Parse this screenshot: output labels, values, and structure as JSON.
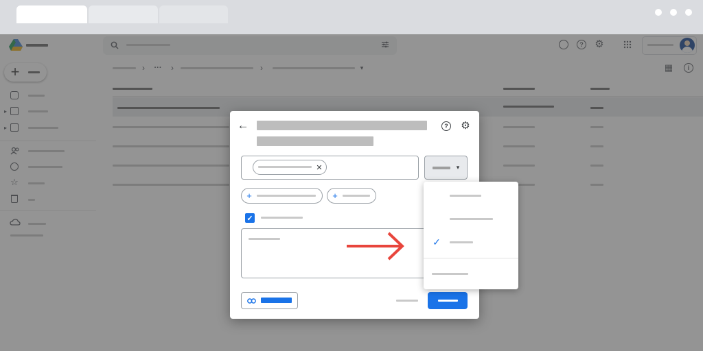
{
  "colors": {
    "accent": "#1a73e8",
    "annotation_arrow": "#e8453c",
    "chrome": "#dadce0",
    "overlay": "rgba(60,60,60,0.55)"
  },
  "icons": {
    "back": "←",
    "help": "?",
    "settings": "⚙",
    "remove_chip": "✕",
    "caret": "▾",
    "check": "✓",
    "checkbox_checked": "✓",
    "add": "+",
    "link": "⛓",
    "new": "+",
    "breadcrumb_sep": "›",
    "more": "···",
    "apps": "⋮⋮⋮",
    "grid_view": "▦",
    "info": "i"
  },
  "dropdown": {
    "selected_index": 2
  },
  "checkbox": {
    "checked": true
  }
}
